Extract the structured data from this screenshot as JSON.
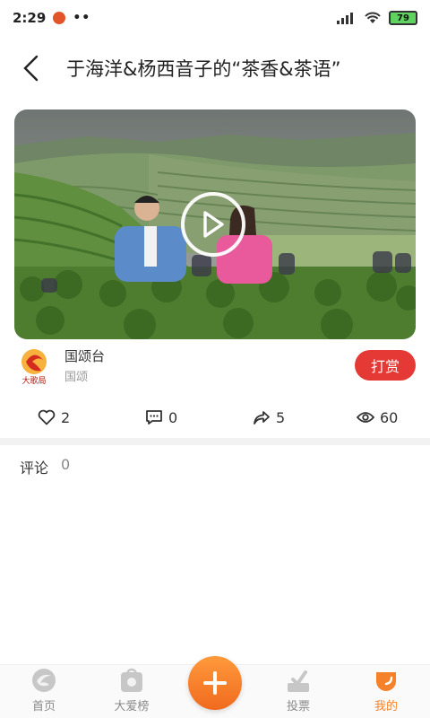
{
  "status": {
    "time": "2:29",
    "dots": "••",
    "battery": "79"
  },
  "header": {
    "title": "于海洋&杨西音子的“茶香&茶语”"
  },
  "author": {
    "name": "国颂台",
    "sub": "国颂",
    "reward_label": "打赏",
    "logo_text": "大歌局"
  },
  "stats": {
    "likes": "2",
    "comments": "0",
    "shares": "5",
    "views": "60"
  },
  "comments": {
    "label": "评论",
    "count": "0"
  },
  "tabs": [
    {
      "label": "首页",
      "icon": "home-icon"
    },
    {
      "label": "大爱榜",
      "icon": "bag-icon"
    },
    {
      "label": "投票",
      "icon": "vote-icon"
    },
    {
      "label": "我的",
      "icon": "profile-icon"
    }
  ],
  "colors": {
    "accent": "#e53935",
    "tab_active": "#f5822b",
    "add_button": "#f5822b"
  }
}
